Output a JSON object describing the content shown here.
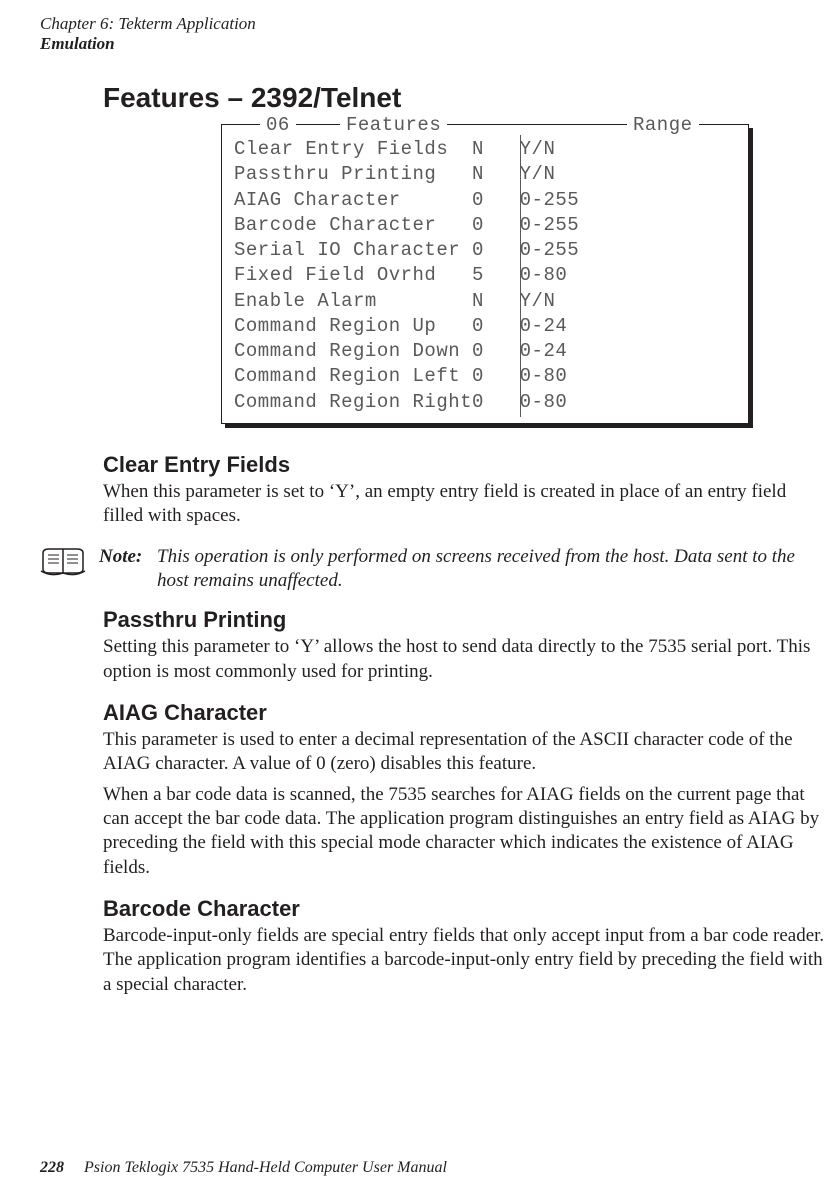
{
  "header": {
    "chapter_line": "Chapter 6: Tekterm Application",
    "section_line": "Emulation"
  },
  "title": "Features – 2392/Telnet",
  "screen": {
    "num": "06",
    "features_label": "Features",
    "range_label": "Range",
    "rows": [
      {
        "label": "Clear Entry Fields",
        "val": "N",
        "range": "Y/N"
      },
      {
        "label": "Passthru Printing",
        "val": "N",
        "range": "Y/N"
      },
      {
        "label": "AIAG Character",
        "val": "0",
        "range": "0-255"
      },
      {
        "label": "Barcode Character",
        "val": "0",
        "range": "0-255"
      },
      {
        "label": "Serial IO Character",
        "val": "0",
        "range": "0-255"
      },
      {
        "label": "Fixed Field Ovrhd",
        "val": "5",
        "range": "0-80"
      },
      {
        "label": "Enable Alarm",
        "val": "N",
        "range": "Y/N"
      },
      {
        "label": "Command Region Up",
        "val": "0",
        "range": "0-24"
      },
      {
        "label": "Command Region Down",
        "val": "0",
        "range": "0-24"
      },
      {
        "label": "Command Region Left",
        "val": "0",
        "range": "0-80"
      },
      {
        "label": "Command Region Right",
        "val": "0",
        "range": "0-80"
      }
    ]
  },
  "sections": {
    "clear_entry": {
      "heading": "Clear Entry Fields",
      "para": "When this parameter is set to ‘Y’, an empty entry field is created in place of an entry field filled with spaces."
    },
    "note": {
      "label": "Note:",
      "body": "This operation is only performed on screens received from the host. Data sent to the host remains unaffected."
    },
    "passthru": {
      "heading": "Passthru Printing",
      "para": "Setting this parameter to ‘Y’ allows the host to send data directly to the 7535 serial port. This option is most commonly used for printing."
    },
    "aiag": {
      "heading": "AIAG Character",
      "para1": "This parameter is used to enter a decimal representation of the ASCII character code of the AIAG character. A value of 0 (zero) disables this feature.",
      "para2": "When a bar code data is scanned, the 7535 searches for AIAG fields on the current page that can accept the bar code data. The application program distinguishes an entry field as AIAG by preceding the field with this special mode character which indicates the existence of AIAG fields."
    },
    "barcode": {
      "heading": "Barcode Character",
      "para": "Barcode-input-only fields are special entry fields that only accept input from a bar code reader. The application program identifies a barcode-input-only entry field by preceding the field with a special character."
    }
  },
  "footer": {
    "page": "228",
    "text": "Psion Teklogix 7535 Hand-Held Computer User Manual"
  }
}
